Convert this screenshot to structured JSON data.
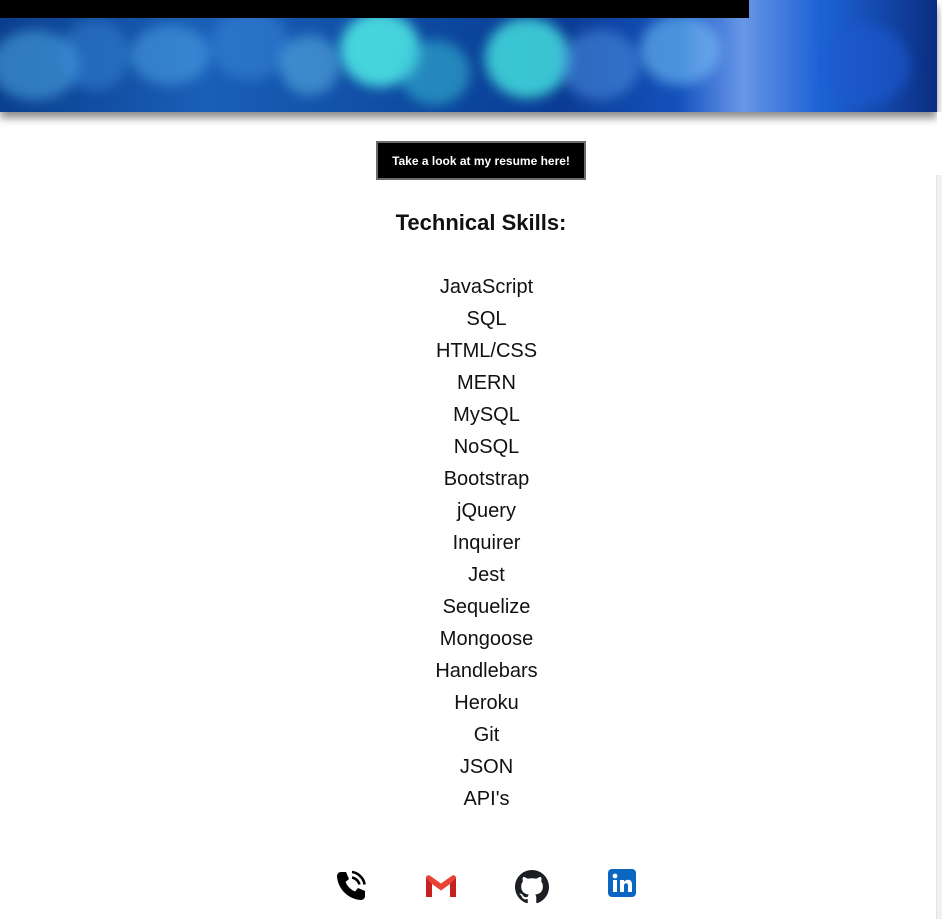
{
  "resume_button": {
    "label": "Take a look at my resume here!"
  },
  "skills": {
    "heading": "Technical Skills:",
    "items": [
      "JavaScript",
      "SQL",
      "HTML/CSS",
      "MERN",
      "MySQL",
      "NoSQL",
      "Bootstrap",
      "jQuery",
      "Inquirer",
      "Jest",
      "Sequelize",
      "Mongoose",
      "Handlebars",
      "Heroku",
      "Git",
      "JSON",
      "API's"
    ]
  },
  "contact_icons": [
    {
      "name": "phone-icon",
      "color": "#000000"
    },
    {
      "name": "gmail-icon",
      "color": "#EA4335"
    },
    {
      "name": "github-icon",
      "color": "#000000"
    },
    {
      "name": "linkedin-icon",
      "color": "#0A66C2"
    }
  ],
  "colors": {
    "banner_blue": "#0b3c94",
    "button_bg": "#000000",
    "button_text": "#ffffff"
  }
}
